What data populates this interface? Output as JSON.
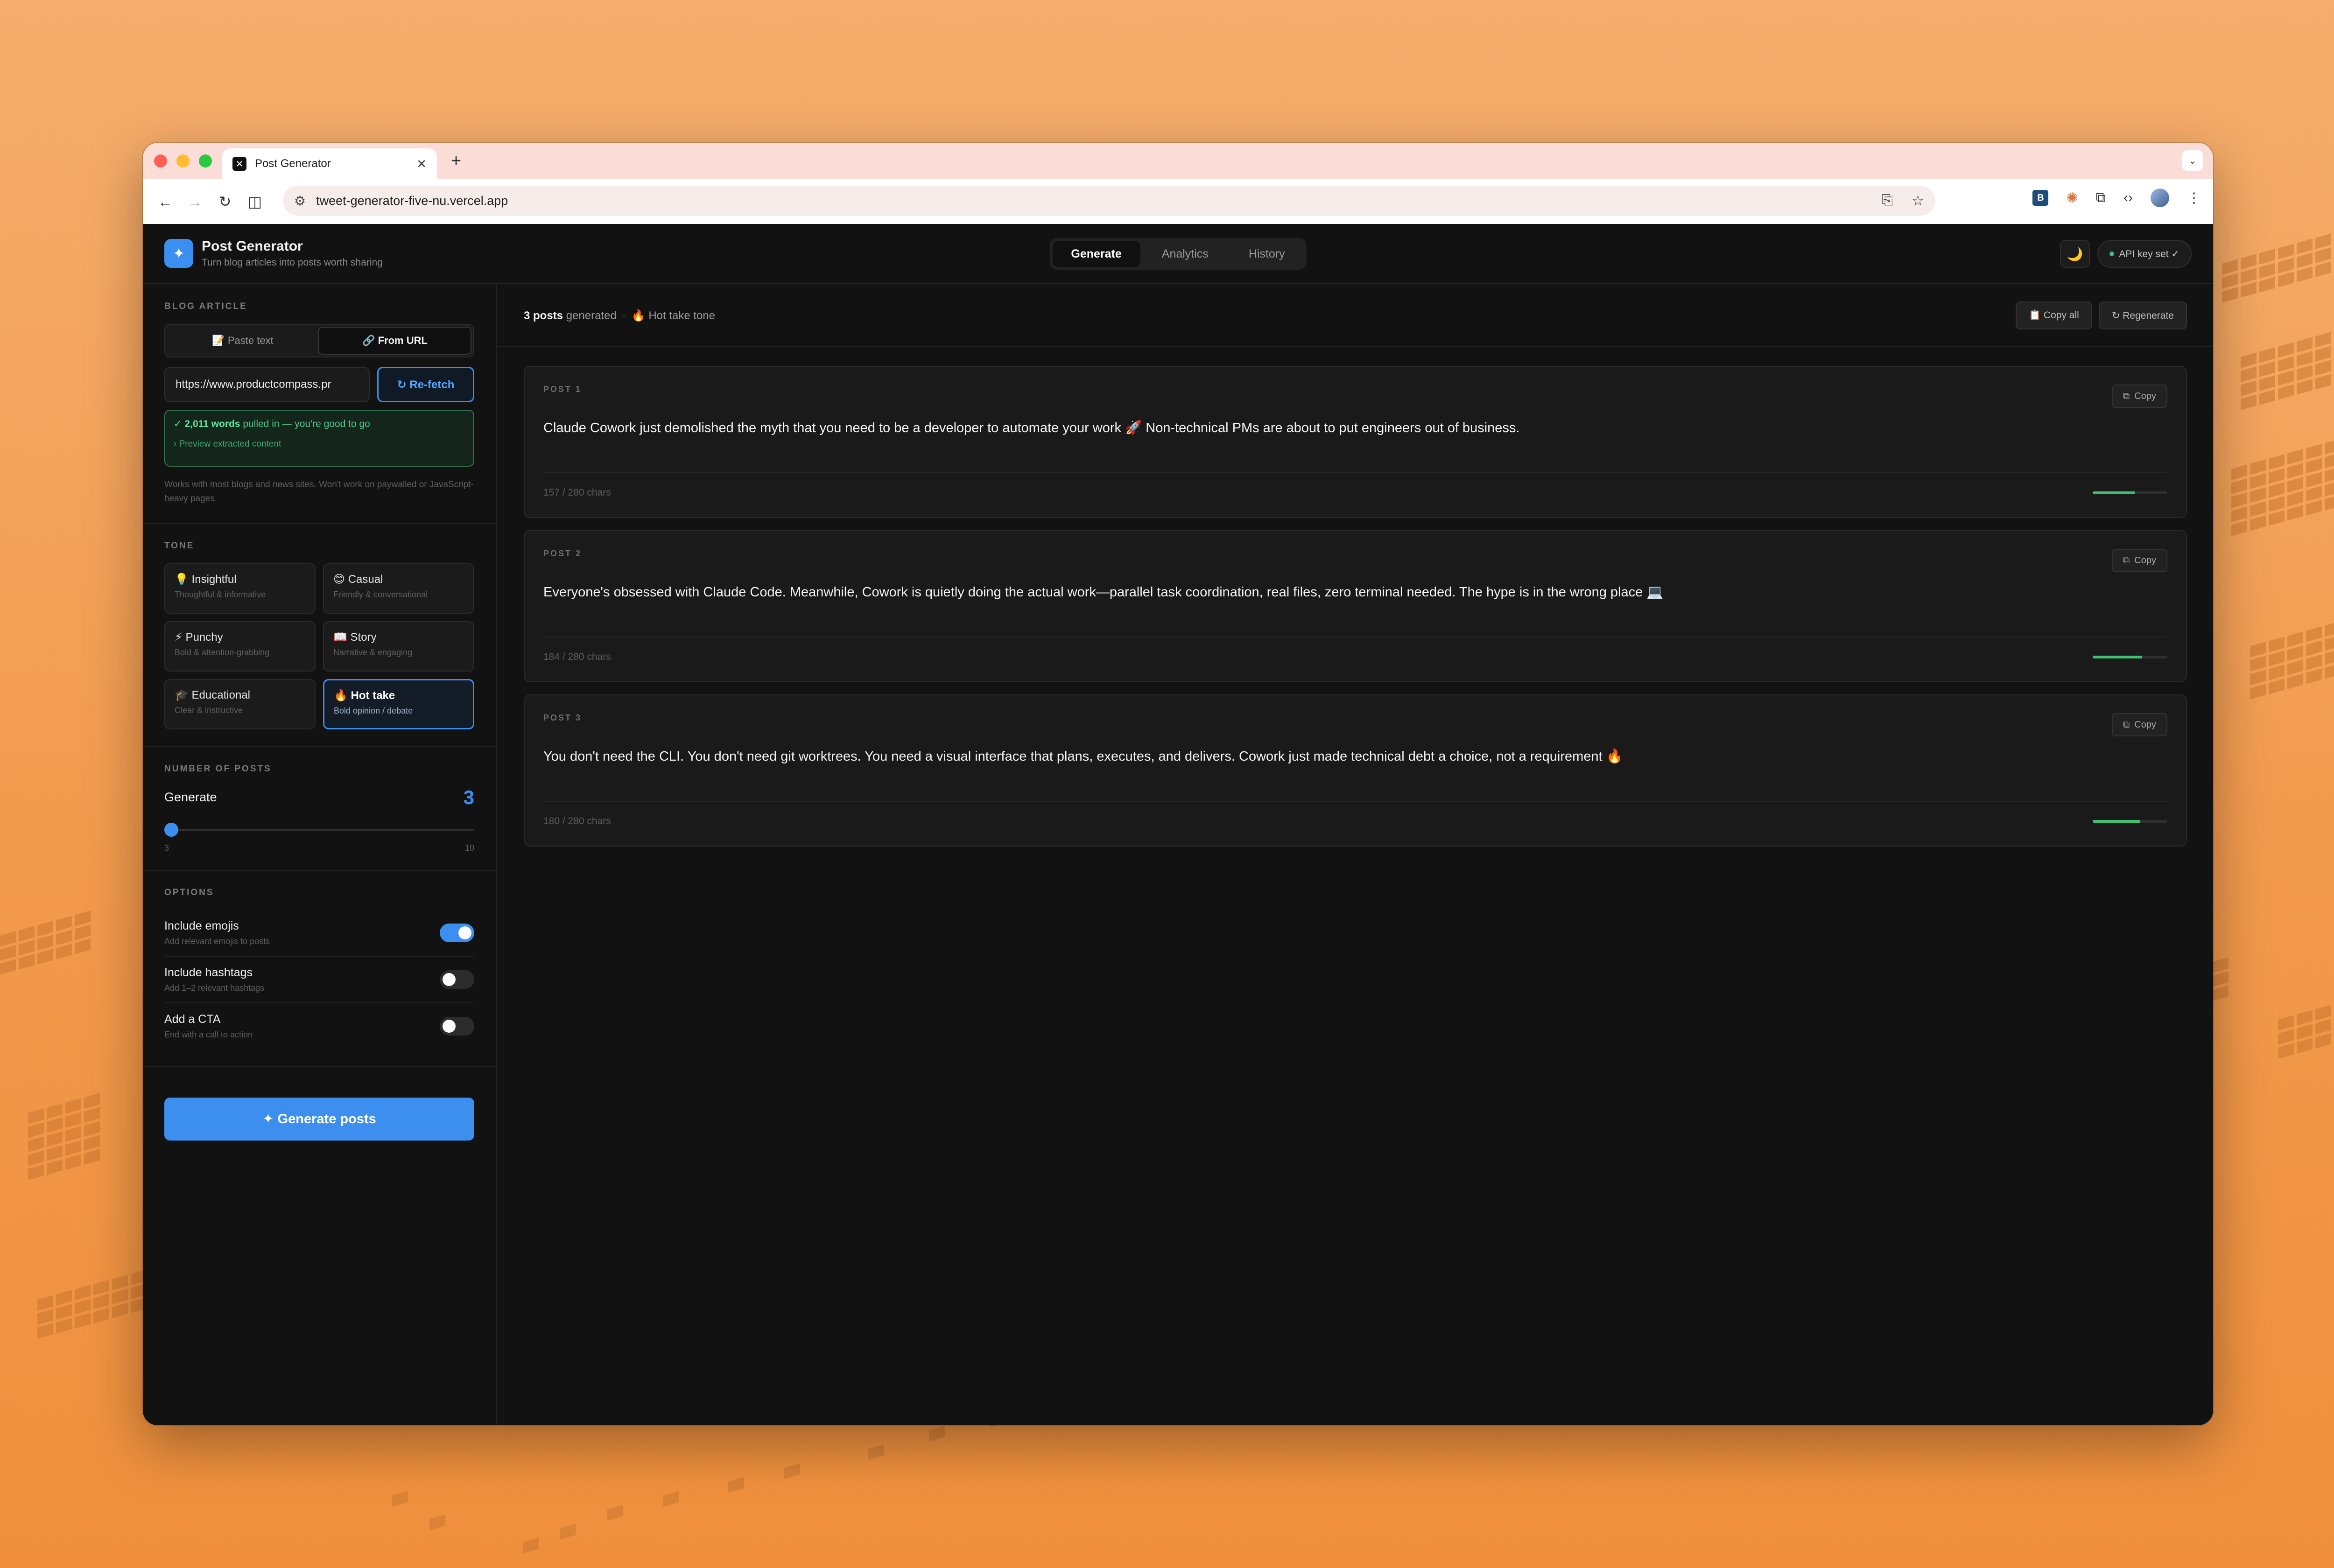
{
  "browser": {
    "tab_title": "Post Generator",
    "url": "tweet-generator-five-nu.vercel.app",
    "new_tab": "+",
    "favicon": "✕"
  },
  "app": {
    "title": "Post Generator",
    "subtitle": "Turn blog articles into posts worth sharing",
    "logo": "✦",
    "nav": [
      "Generate",
      "Analytics",
      "History"
    ],
    "theme_icon": "🌙",
    "api_badge": "API key set ✓"
  },
  "sidebar": {
    "article": {
      "label": "BLOG ARTICLE",
      "paste_tab": "📝 Paste text",
      "url_tab": "🔗 From URL",
      "url_value": "https://www.productcompass.pr",
      "refetch": "↻ Re-fetch",
      "success_words": "✓ 2,011 words",
      "success_rest": " pulled in — you're good to go",
      "preview": "› Preview extracted content",
      "hint": "Works with most blogs and news sites. Won't work on paywalled or JavaScript-heavy pages."
    },
    "tone": {
      "label": "TONE",
      "options": [
        {
          "title": "💡 Insightful",
          "sub": "Thoughtful & informative"
        },
        {
          "title": "😊 Casual",
          "sub": "Friendly & conversational"
        },
        {
          "title": "⚡ Punchy",
          "sub": "Bold & attention-grabbing"
        },
        {
          "title": "📖 Story",
          "sub": "Narrative & engaging"
        },
        {
          "title": "🎓 Educational",
          "sub": "Clear & instructive"
        },
        {
          "title": "🔥 Hot take",
          "sub": "Bold opinion / debate"
        }
      ],
      "selected": "Hot take"
    },
    "count": {
      "label": "NUMBER OF POSTS",
      "title": "Generate",
      "value": "3",
      "min": "3",
      "max": "10",
      "fraction": 0
    },
    "options": {
      "label": "OPTIONS",
      "items": [
        {
          "title": "Include emojis",
          "sub": "Add relevant emojis to posts",
          "on": true
        },
        {
          "title": "Include hashtags",
          "sub": "Add 1–2 relevant hashtags",
          "on": false
        },
        {
          "title": "Add a CTA",
          "sub": "End with a call to action",
          "on": false
        }
      ]
    },
    "generate_button": "✦ Generate posts"
  },
  "main": {
    "summary_count": "3 posts",
    "summary_generated": " generated",
    "summary_tone": "🔥 Hot take tone",
    "copy_all": "📋 Copy all",
    "regenerate": "↻ Regenerate",
    "copy_label": "Copy",
    "posts": [
      {
        "label": "POST 1",
        "text": "Claude Cowork just demolished the myth that you need to be a developer to automate your work 🚀 Non-technical PMs are about to put engineers out of business.",
        "chars": "157 / 280 chars",
        "fraction": 0.56
      },
      {
        "label": "POST 2",
        "text": "Everyone's obsessed with Claude Code. Meanwhile, Cowork is quietly doing the actual work—parallel task coordination, real files, zero terminal needed. The hype is in the wrong place 💻",
        "chars": "184 / 280 chars",
        "fraction": 0.66
      },
      {
        "label": "POST 3",
        "text": "You don't need the CLI. You don't need git worktrees. You need a visual interface that plans, executes, and delivers. Cowork just made technical debt a choice, not a requirement 🔥",
        "chars": "180 / 280 chars",
        "fraction": 0.64
      }
    ]
  },
  "colors": {
    "accent": "#3b8ff0",
    "success": "#3fbf6f",
    "background": "#121212"
  }
}
